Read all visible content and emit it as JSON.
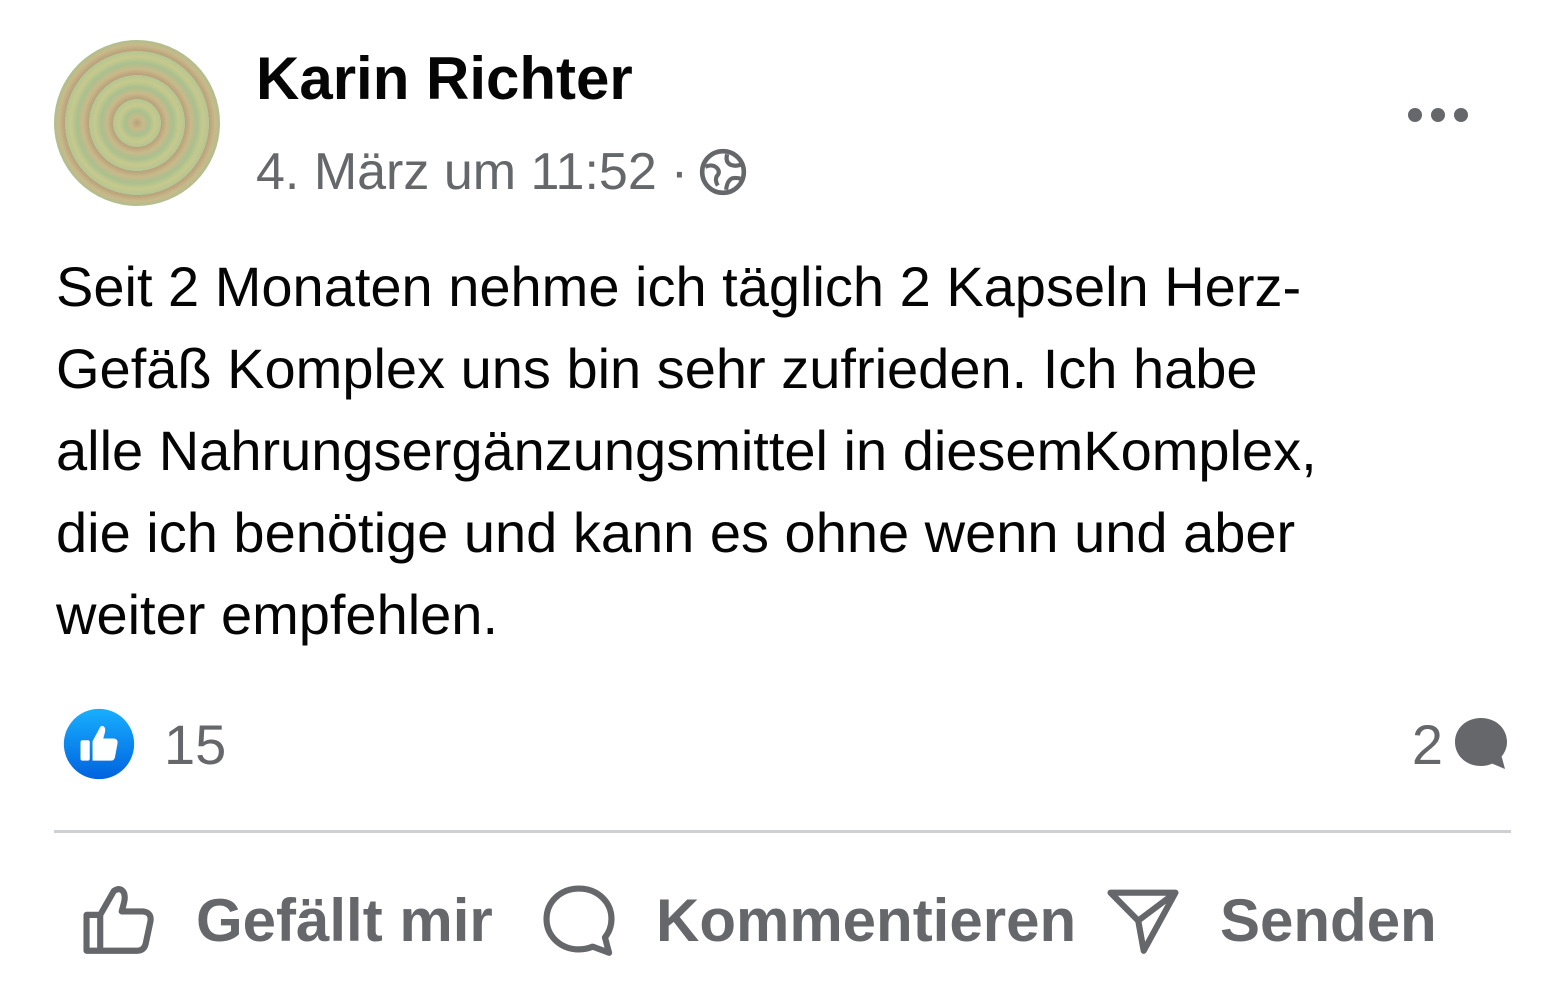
{
  "post": {
    "author": "Karin Richter",
    "timestamp": "4. März um 11:52",
    "separator": "·",
    "privacy_icon": "globe-icon",
    "more_icon": "more-options-icon",
    "text": "Seit 2 Monaten nehme ich täglich 2 Kapseln Herz-\nGefäß Komplex uns bin sehr zufrieden. Ich habe\nalle Nahrungsergänzungsmittel in diesemKomplex,\ndie ich benötige und kann es ohne wenn und aber\nweiter empfehlen.",
    "reactions": {
      "icon": "like-reaction-icon",
      "count": "15"
    },
    "comments": {
      "count": "2",
      "icon": "comment-bubble-icon"
    }
  },
  "actions": {
    "like_label": "Gefällt mir",
    "comment_label": "Kommentieren",
    "send_label": "Senden"
  },
  "colors": {
    "text_primary": "#050505",
    "text_secondary": "#65676b",
    "like_blue": "#0866ff",
    "divider": "#ced0d4"
  }
}
